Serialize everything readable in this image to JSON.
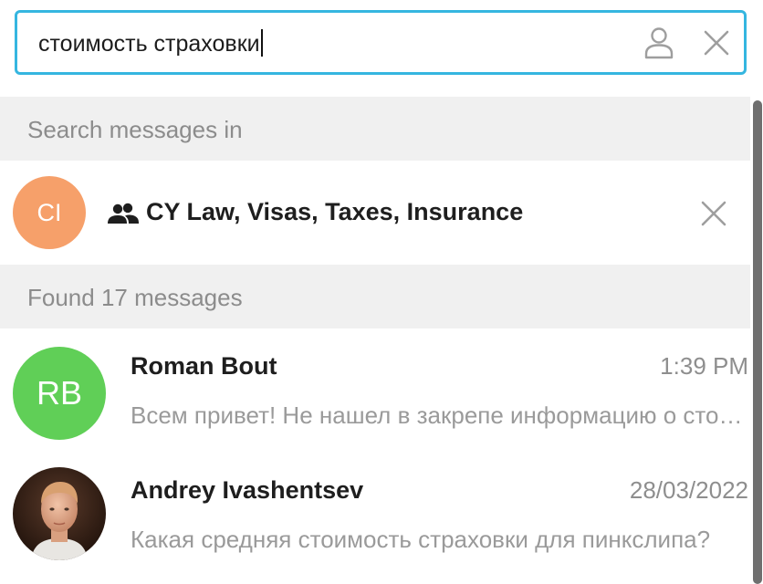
{
  "search": {
    "query": "стоимость страховки"
  },
  "search_in": {
    "header": "Search messages in",
    "chat": {
      "avatar_initials": "CI",
      "avatar_color": "#f6a06a",
      "name": "CY Law, Visas, Taxes, Insurance",
      "type_icon": "group-icon"
    }
  },
  "results": {
    "header": "Found 17 messages",
    "messages": [
      {
        "sender": "Roman Bout",
        "time": "1:39 PM",
        "preview": "Всем привет! Не нашел в закрепе информацию о стоимости страховки",
        "avatar_initials": "RB",
        "avatar_color": "#60cf57"
      },
      {
        "sender": "Andrey Ivashentsev",
        "time": "28/03/2022",
        "preview": "Какая средняя стоимость страховки для пинкслипа?",
        "avatar_photo": true
      }
    ]
  },
  "colors": {
    "accent": "#35b6e0",
    "section_bg": "#f0f0f0",
    "muted_text": "#8c8c8c"
  }
}
